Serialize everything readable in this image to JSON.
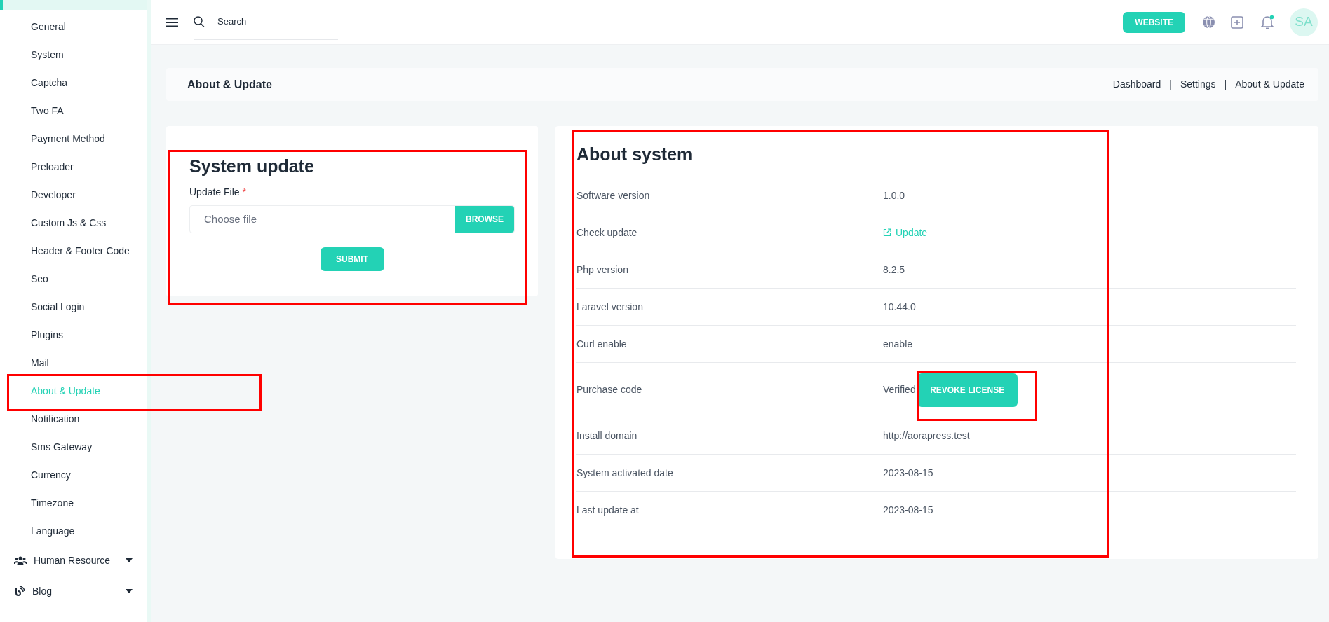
{
  "sidebar": {
    "items": [
      {
        "label": "General",
        "selected": false
      },
      {
        "label": "System",
        "selected": false
      },
      {
        "label": "Captcha",
        "selected": false
      },
      {
        "label": "Two FA",
        "selected": false
      },
      {
        "label": "Payment Method",
        "selected": false
      },
      {
        "label": "Preloader",
        "selected": false
      },
      {
        "label": "Developer",
        "selected": false
      },
      {
        "label": "Custom Js & Css",
        "selected": false
      },
      {
        "label": "Header & Footer Code",
        "selected": false
      },
      {
        "label": "Seo",
        "selected": false
      },
      {
        "label": "Social Login",
        "selected": false
      },
      {
        "label": "Plugins",
        "selected": false
      },
      {
        "label": "Mail",
        "selected": false
      },
      {
        "label": "About & Update",
        "selected": true
      },
      {
        "label": "Notification",
        "selected": false
      },
      {
        "label": "Sms Gateway",
        "selected": false
      },
      {
        "label": "Currency",
        "selected": false
      },
      {
        "label": "Timezone",
        "selected": false
      },
      {
        "label": "Language",
        "selected": false
      }
    ],
    "groups": [
      {
        "label": "Human Resource",
        "kind": "people",
        "expanded": false
      },
      {
        "label": "Blog",
        "kind": "feed",
        "expanded": false
      }
    ]
  },
  "topbar": {
    "search": {
      "placeholder": "Search"
    },
    "website_button": "WEBSITE",
    "notification_unread": true,
    "avatar": "SA"
  },
  "page_title": "About & Update",
  "breadcrumb": [
    {
      "label": "Dashboard",
      "separator": "|"
    },
    {
      "label": "Settings",
      "separator": "|"
    },
    {
      "label": "About & Update"
    }
  ],
  "update_card": {
    "title": "System update",
    "field_label": "Update File",
    "required_mark": "*",
    "placeholder": "Choose file",
    "browse_button": "BROWSE",
    "submit_button": "SUBMIT"
  },
  "about_card": {
    "title": "About system",
    "rows": [
      {
        "label": "Software version",
        "kind": "text",
        "value": "1.0.0"
      },
      {
        "label": "Check update",
        "kind": "link",
        "value": "Update"
      },
      {
        "label": "Php version",
        "kind": "text",
        "value": "8.2.5"
      },
      {
        "label": "Laravel version",
        "kind": "text",
        "value": "10.44.0"
      },
      {
        "label": "Curl enable",
        "kind": "text",
        "value": "enable"
      },
      {
        "label": "Purchase code",
        "kind": "license",
        "value": "Verified",
        "button": "REVOKE LICENSE"
      },
      {
        "label": "Install domain",
        "kind": "text",
        "value": "http://aorapress.test"
      },
      {
        "label": "System activated date",
        "kind": "text",
        "value": "2023-08-15"
      },
      {
        "label": "Last update at",
        "kind": "text",
        "value": "2023-08-15"
      }
    ]
  }
}
